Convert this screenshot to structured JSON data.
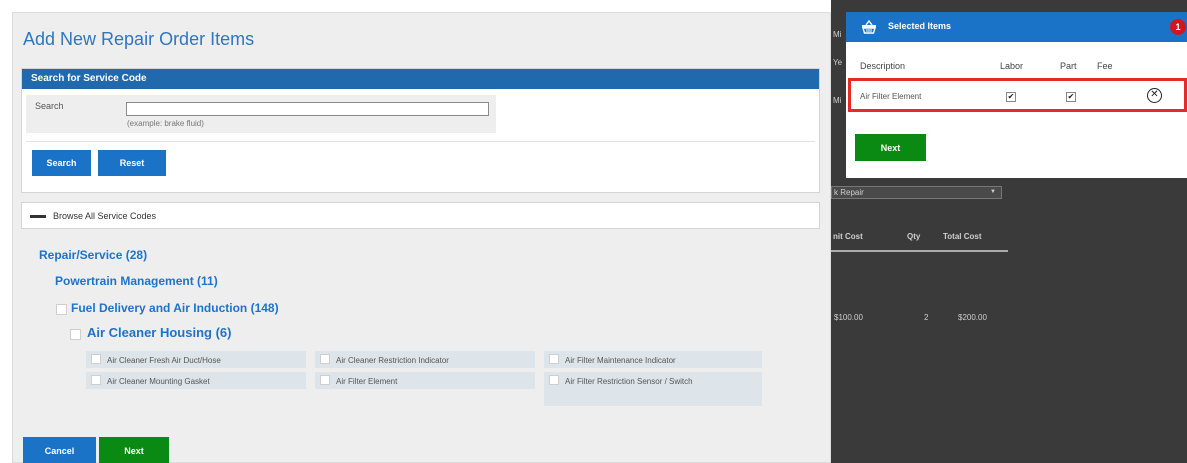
{
  "modal": {
    "title": "Add New Repair Order Items",
    "search_panel": {
      "header": "Search for Service Code",
      "label": "Search",
      "value": "",
      "hint": "(example: brake fluid)",
      "search_button": "Search",
      "reset_button": "Reset"
    },
    "browse": {
      "label": "Browse All Service Codes"
    },
    "tree": {
      "level1": "Repair/Service (28)",
      "level2": "Powertrain Management (11)",
      "level3": "Fuel Delivery and Air Induction (148)",
      "level4": "Air Cleaner Housing (6)",
      "leaves": [
        "Air Cleaner Fresh Air Duct/Hose",
        "Air Cleaner Restriction Indicator",
        "Air Filter Maintenance Indicator",
        "Air Cleaner Mounting Gasket",
        "Air Filter Element",
        "Air Filter Restriction Sensor / Switch"
      ]
    },
    "cancel_button": "Cancel",
    "next_button": "Next"
  },
  "background": {
    "select_value": "k Repair",
    "columns": [
      "nit Cost",
      "Qty",
      "Total Cost"
    ],
    "row": [
      "$100.00",
      "2",
      "$200.00"
    ],
    "fragments": [
      "Mi",
      "Ye",
      "Mi"
    ]
  },
  "selected": {
    "title": "Selected Items",
    "badge": "1",
    "columns": {
      "description": "Description",
      "labor": "Labor",
      "part": "Part",
      "fee": "Fee"
    },
    "items": [
      {
        "description": "Air Filter Element",
        "labor": true,
        "part": true
      }
    ],
    "next_button": "Next"
  },
  "colors": {
    "header_blue": "#1a73c7",
    "title_blue": "#2e76bd",
    "green": "#0b8a13",
    "badge_red": "#d0171e",
    "highlight_red": "#e52a2a"
  }
}
